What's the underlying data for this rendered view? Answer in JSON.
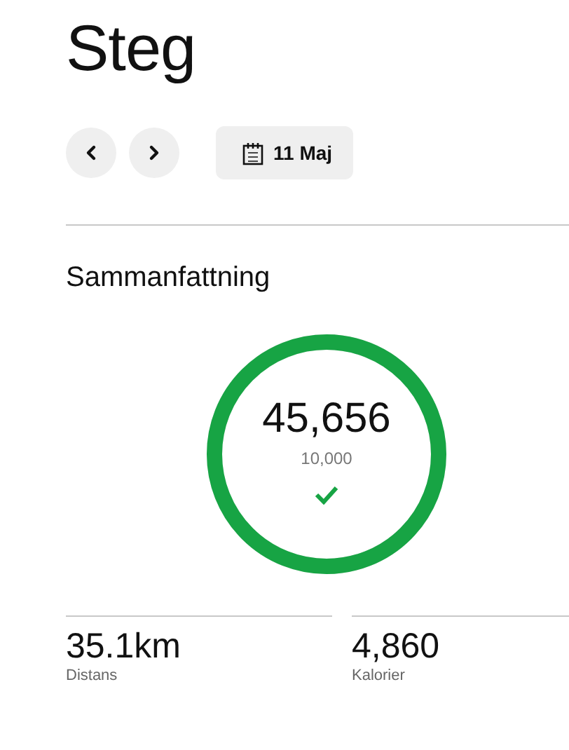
{
  "title": "Steg",
  "date_nav": {
    "previous": {
      "kind": "prev"
    },
    "next": {
      "kind": "next"
    },
    "date": "11 Maj"
  },
  "summary": {
    "heading": "Sammanfattning",
    "steps": "45,656",
    "goal": "10,000",
    "level": 1,
    "goal_reached": true
  },
  "stats": [
    {
      "value": "35.1km",
      "label": "Distans"
    },
    {
      "value": "4,860",
      "label": "Kalorier"
    }
  ]
}
